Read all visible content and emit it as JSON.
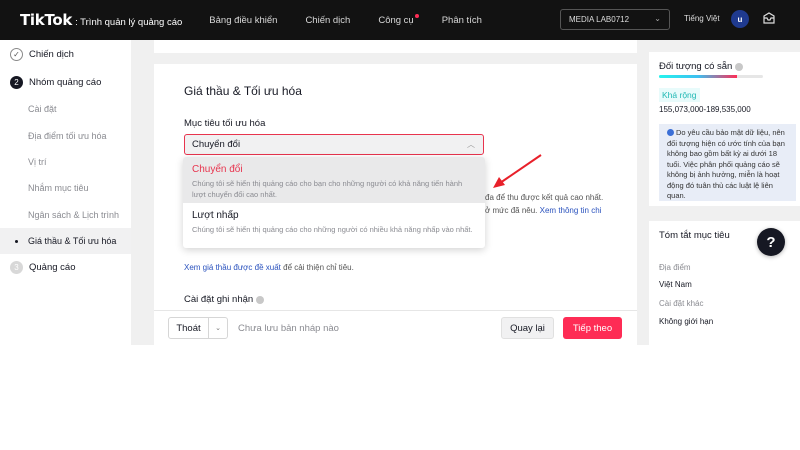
{
  "header": {
    "brand": "TikTok",
    "subtitle": ": Trình quản lý quảng cáo",
    "nav": [
      "Bảng điều khiển",
      "Chiến dịch",
      "Công cụ",
      "Phân tích"
    ],
    "account": "MEDIA LAB0712",
    "language": "Tiếng Việt",
    "avatar": "u"
  },
  "sidebar": {
    "step1": {
      "num": "✓",
      "label": "Chiến dịch"
    },
    "step2": {
      "num": "2",
      "label": "Nhóm quảng cáo"
    },
    "subs": [
      "Cài đặt",
      "Địa điểm tối ưu hóa",
      "Vị trí",
      "Nhắm mục tiêu",
      "Ngân sách & Lịch trình",
      "Giá thầu & Tối ưu hóa"
    ],
    "step3": {
      "num": "3",
      "label": "Quảng cáo"
    }
  },
  "main": {
    "section_title": "Giá thầu & Tối ưu hóa",
    "goal_label": "Mục tiêu tối ưu hóa",
    "goal_value": "Chuyển đổi",
    "behind_1": "đa để thu được kết quả cao nhất.",
    "behind_2_text": "ở mức đã nêu.",
    "behind_2_link": "Xem thông tin chi",
    "suggest_link": "Xem giá thầu được đề xuất",
    "suggest_text": " để cải thiện chỉ tiêu.",
    "section2": "Cài đặt ghi nhận"
  },
  "dropdown": {
    "options": [
      {
        "title": "Chuyển đổi",
        "desc": "Chúng tôi sẽ hiển thị quảng cáo cho bạn cho những người có khả năng tiến hành lượt chuyển đổi cao nhất."
      },
      {
        "title": "Lượt nhấp",
        "desc": "Chúng tôi sẽ hiển thị quảng cáo cho những người có nhiều khả năng nhấp vào nhất."
      }
    ]
  },
  "footer": {
    "exit": "Thoát",
    "draft": "Chưa lưu bản nháp nào",
    "back": "Quay lại",
    "next": "Tiếp theo"
  },
  "audience": {
    "title": "Đối tượng có sẵn",
    "level": 0.75,
    "tag": "Khá rộng",
    "range": "155,073,000-189,535,000",
    "notice": "Do yêu cầu bảo mật dữ liệu, nên đối tượng hiện có ước tính của bạn không bao gồm bất kỳ ai dưới 18 tuổi. Việc phân phối quảng cáo sẽ không bị ảnh hưởng, miễn là hoạt động đó tuân thủ các luật lệ liên quan."
  },
  "summary": {
    "title": "Tóm tắt mục tiêu",
    "location_label": "Địa điểm",
    "location_value": "Việt Nam",
    "other_label": "Cài đặt khác",
    "other_value": "Không giới hạn"
  },
  "help": "?",
  "colors": {
    "accent": "#fe2c55",
    "topbar": "#121212",
    "link": "#2a52be"
  }
}
